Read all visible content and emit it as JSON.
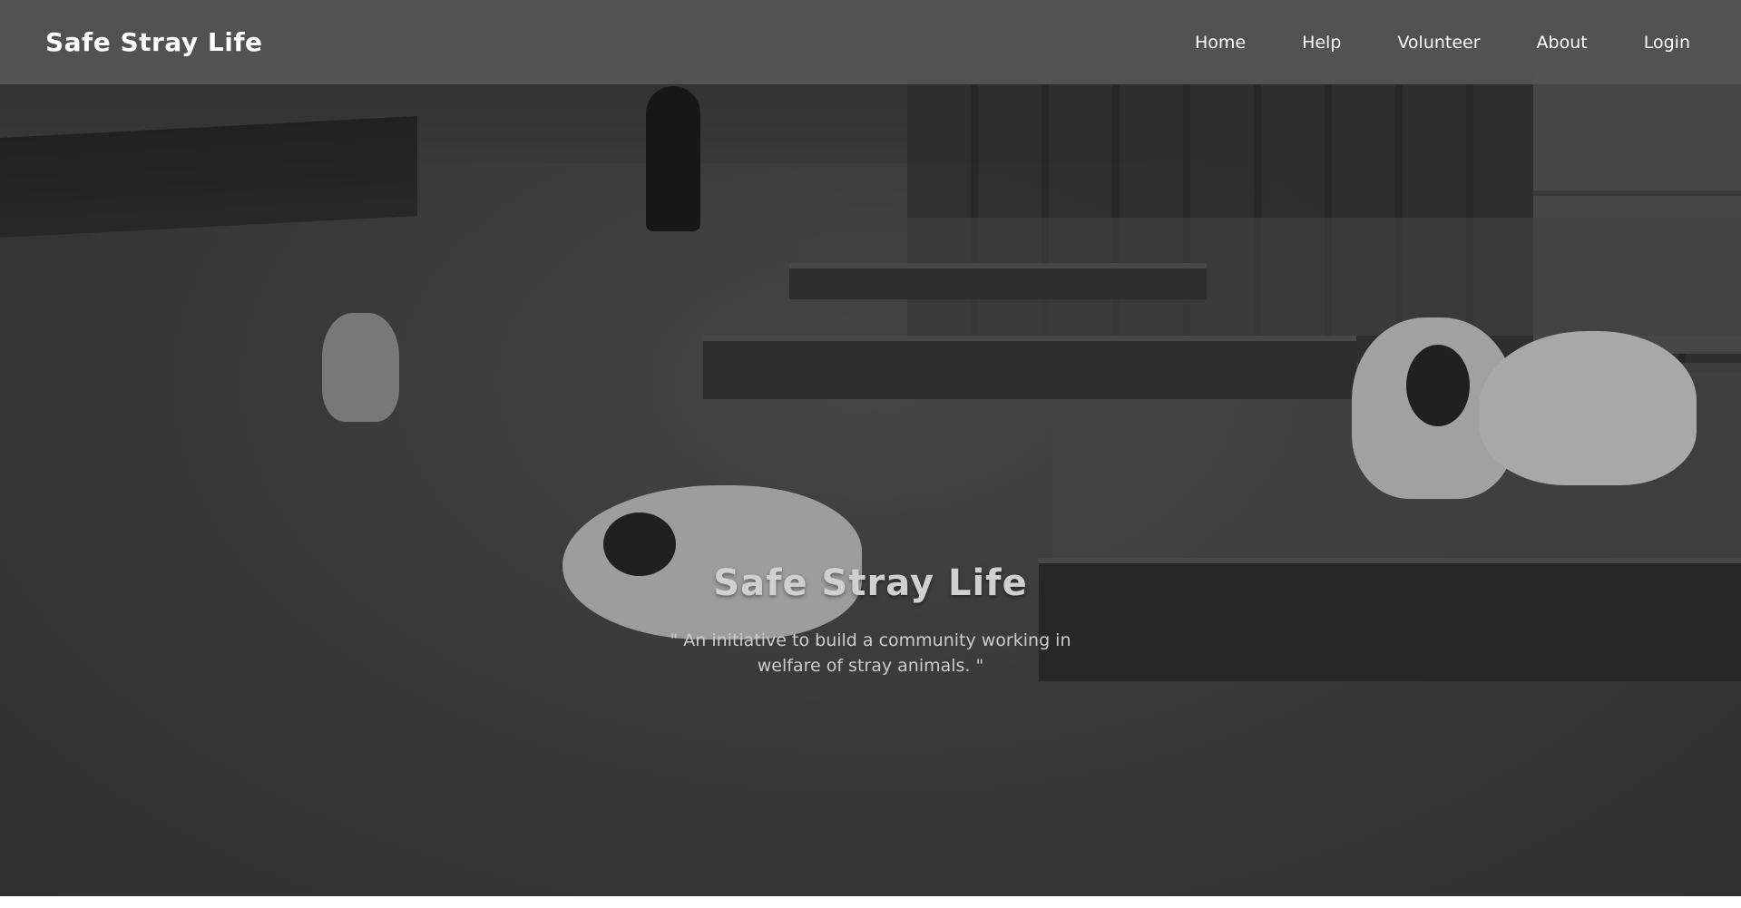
{
  "navbar": {
    "brand": "Safe Stray Life",
    "links": [
      {
        "label": "Home"
      },
      {
        "label": "Help"
      },
      {
        "label": "Volunteer"
      },
      {
        "label": "About"
      },
      {
        "label": "Login"
      }
    ]
  },
  "hero": {
    "title": "Safe Stray Life",
    "tagline": "\" An initiative to build a community working in welfare of stray animals. \""
  },
  "colors": {
    "navbar_background": "#555555",
    "nav_text": "#ffffff",
    "hero_title": "#d0d0d0",
    "hero_tagline": "#cccccc",
    "page_background": "#ffffff"
  }
}
